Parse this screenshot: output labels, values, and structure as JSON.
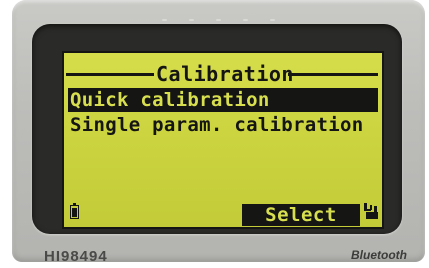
{
  "screen": {
    "title": "Calibration",
    "menu_items": [
      {
        "label": "Quick calibration",
        "selected": true
      },
      {
        "label": "Single param. calibration",
        "selected": false
      }
    ],
    "softkey_label": "Select"
  },
  "device": {
    "model": "HI98494",
    "brand": "Bluetooth"
  },
  "colors": {
    "lcd_background": "#cbd43f",
    "lcd_ink": "#151514",
    "housing": "#bdbdba",
    "bezel": "#2a2a28"
  },
  "icons": [
    "battery-icon",
    "menu-corner-icon"
  ]
}
